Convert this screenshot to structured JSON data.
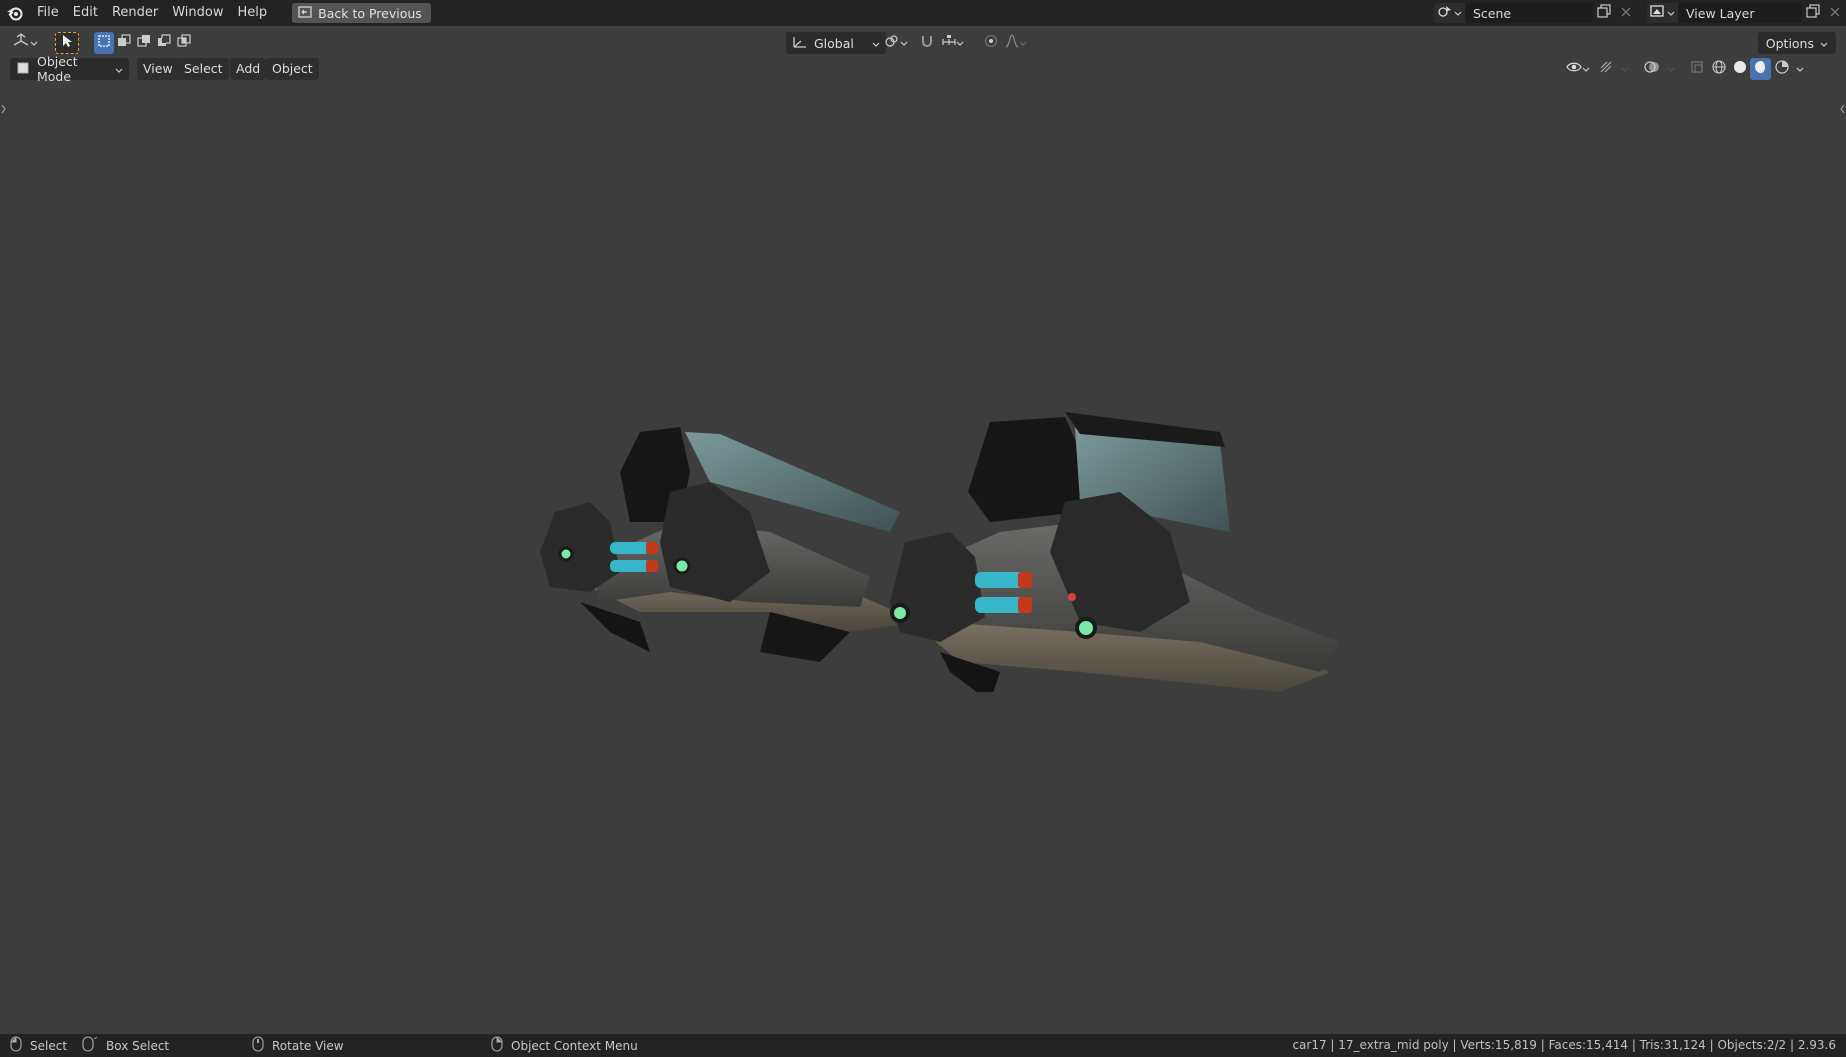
{
  "menubar": {
    "items": [
      "File",
      "Edit",
      "Render",
      "Window",
      "Help"
    ],
    "back_button": "Back to Previous"
  },
  "scene": {
    "label": "Scene"
  },
  "view_layer": {
    "label": "View Layer"
  },
  "toolbar": {
    "transform_orientation": "Global",
    "options_label": "Options"
  },
  "viewport_header": {
    "mode": "Object Mode",
    "menus": [
      "View",
      "Select",
      "Add",
      "Object"
    ]
  },
  "status_bar": {
    "select": "Select",
    "box_select": "Box Select",
    "rotate_view": "Rotate View",
    "context_menu": "Object Context Menu",
    "stats": "car17 | 17_extra_mid poly | Verts:15,819 | Faces:15,414 | Tris:31,124 | Objects:2/2 | 2.93.6"
  },
  "colors": {
    "topbar_bg": "#232323",
    "viewport_bg": "#3d3d3d",
    "select_accent": "#4772b3",
    "tool_highlight": "#e6a135"
  }
}
